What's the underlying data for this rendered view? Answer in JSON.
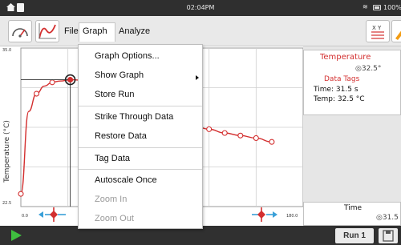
{
  "status_bar": {
    "time": "02:04PM",
    "battery": "100%"
  },
  "toolbar": {
    "menus": [
      "File",
      "Graph",
      "Analyze"
    ],
    "xy_label": "X Y"
  },
  "graph_menu": {
    "items": [
      {
        "label": "Graph Options...",
        "enabled": true
      },
      {
        "label": "Show Graph",
        "enabled": true,
        "has_submenu": true
      },
      {
        "label": "Store Run",
        "enabled": true
      },
      {
        "label": "Strike Through Data",
        "enabled": true
      },
      {
        "label": "Restore Data",
        "enabled": true
      },
      {
        "label": "Tag Data",
        "enabled": true
      },
      {
        "label": "Autoscale Once",
        "enabled": true
      },
      {
        "label": "Zoom In",
        "enabled": false
      },
      {
        "label": "Zoom Out",
        "enabled": false
      }
    ]
  },
  "graph": {
    "y_axis_label": "Temperature (°C)",
    "y_max_label": "35.0",
    "y_min_label": "22.5",
    "x_min_label": "0.0",
    "x_max_label": "180.0",
    "line_color": "#d32f2f"
  },
  "chart_data": {
    "type": "line",
    "ylabel": "Temperature (°C)",
    "xlim": [
      0,
      180
    ],
    "ylim": [
      22.5,
      35.0
    ],
    "grid": true,
    "series": [
      {
        "x": [
          0,
          5,
          10,
          15,
          20,
          25,
          31.5,
          100,
          110,
          120,
          130,
          140,
          150,
          160
        ],
        "y": [
          23.5,
          30.0,
          31.4,
          32.0,
          32.3,
          32.4,
          32.5,
          29.2,
          28.9,
          28.6,
          28.3,
          28.1,
          27.9,
          27.6
        ]
      }
    ],
    "tagged_point": {
      "x": 31.5,
      "y": 32.5
    }
  },
  "meter": {
    "title": "Temperature",
    "value": "32.5°",
    "tags_title": "Data Tags",
    "tag_time": "Time: 31.5 s",
    "tag_temp": "Temp: 32.5 °C"
  },
  "time_meter": {
    "title": "Time",
    "value": "31.5"
  },
  "bottom": {
    "run_label": "Run 1"
  }
}
